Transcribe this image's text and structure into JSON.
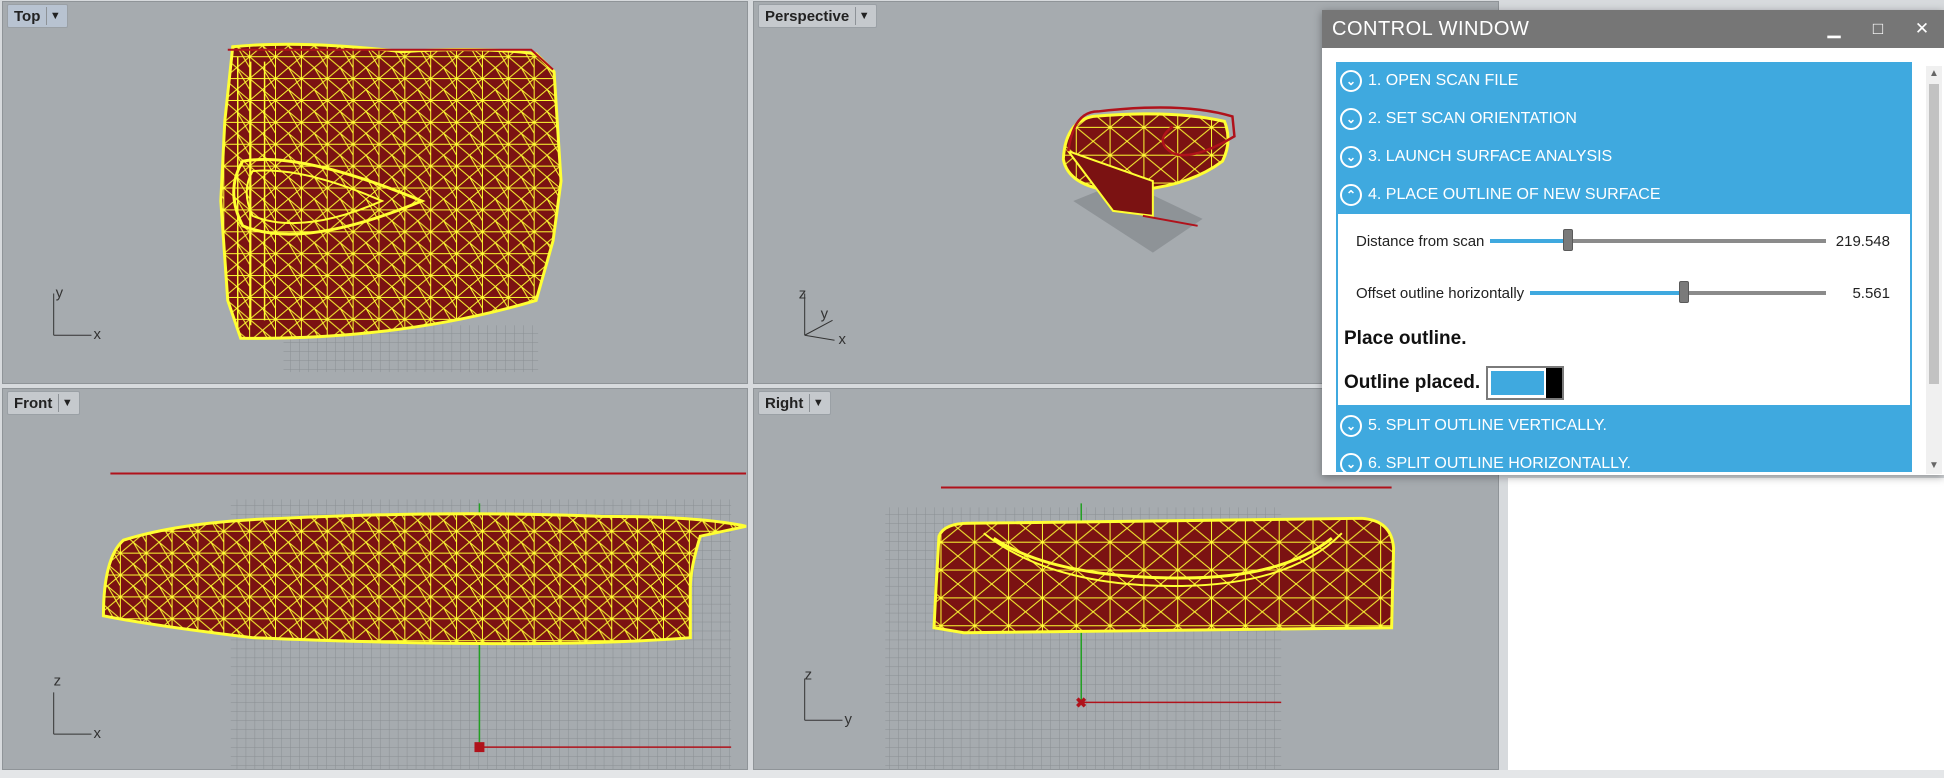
{
  "viewports": {
    "top": {
      "label": "Top",
      "axis_v": "y",
      "axis_h": "x"
    },
    "perspective": {
      "label": "Perspective",
      "axis_z": "z",
      "axis_v": "y",
      "axis_h": "x"
    },
    "front": {
      "label": "Front",
      "axis_v": "z",
      "axis_h": "x"
    },
    "right": {
      "label": "Right",
      "axis_v": "z",
      "axis_h": "y"
    },
    "dropdown_icon": "triangle-down-icon"
  },
  "colors": {
    "viewport_bg": "#a6abaf",
    "mesh": "#ffff33",
    "surface": "#7b1212",
    "curve": "#b0121b",
    "accent": "#3fa9df"
  },
  "control_window": {
    "title": "CONTROL WINDOW",
    "buttons": {
      "minimize": "▁",
      "maximize": "□",
      "close": "✕"
    },
    "sections": [
      {
        "label": "1. OPEN SCAN FILE",
        "state": "collapsed"
      },
      {
        "label": "2. SET SCAN ORIENTATION",
        "state": "collapsed"
      },
      {
        "label": "3. LAUNCH SURFACE ANALYSIS",
        "state": "collapsed"
      },
      {
        "label": "4. PLACE OUTLINE OF NEW SURFACE",
        "state": "expanded"
      },
      {
        "label": "5. SPLIT OUTLINE VERTICALLY.",
        "state": "collapsed"
      },
      {
        "label": "6. SPLIT OUTLINE HORIZONTALLY.",
        "state": "collapsed"
      }
    ],
    "panel": {
      "slider1": {
        "label": "Distance from scan",
        "value": "219.548",
        "level": 0.23
      },
      "slider2": {
        "label": "Offset outline horizontally",
        "value": "5.561",
        "level": 0.52
      },
      "place_label": "Place outline.",
      "placed_label": "Outline placed.",
      "toggle_on": true
    }
  }
}
